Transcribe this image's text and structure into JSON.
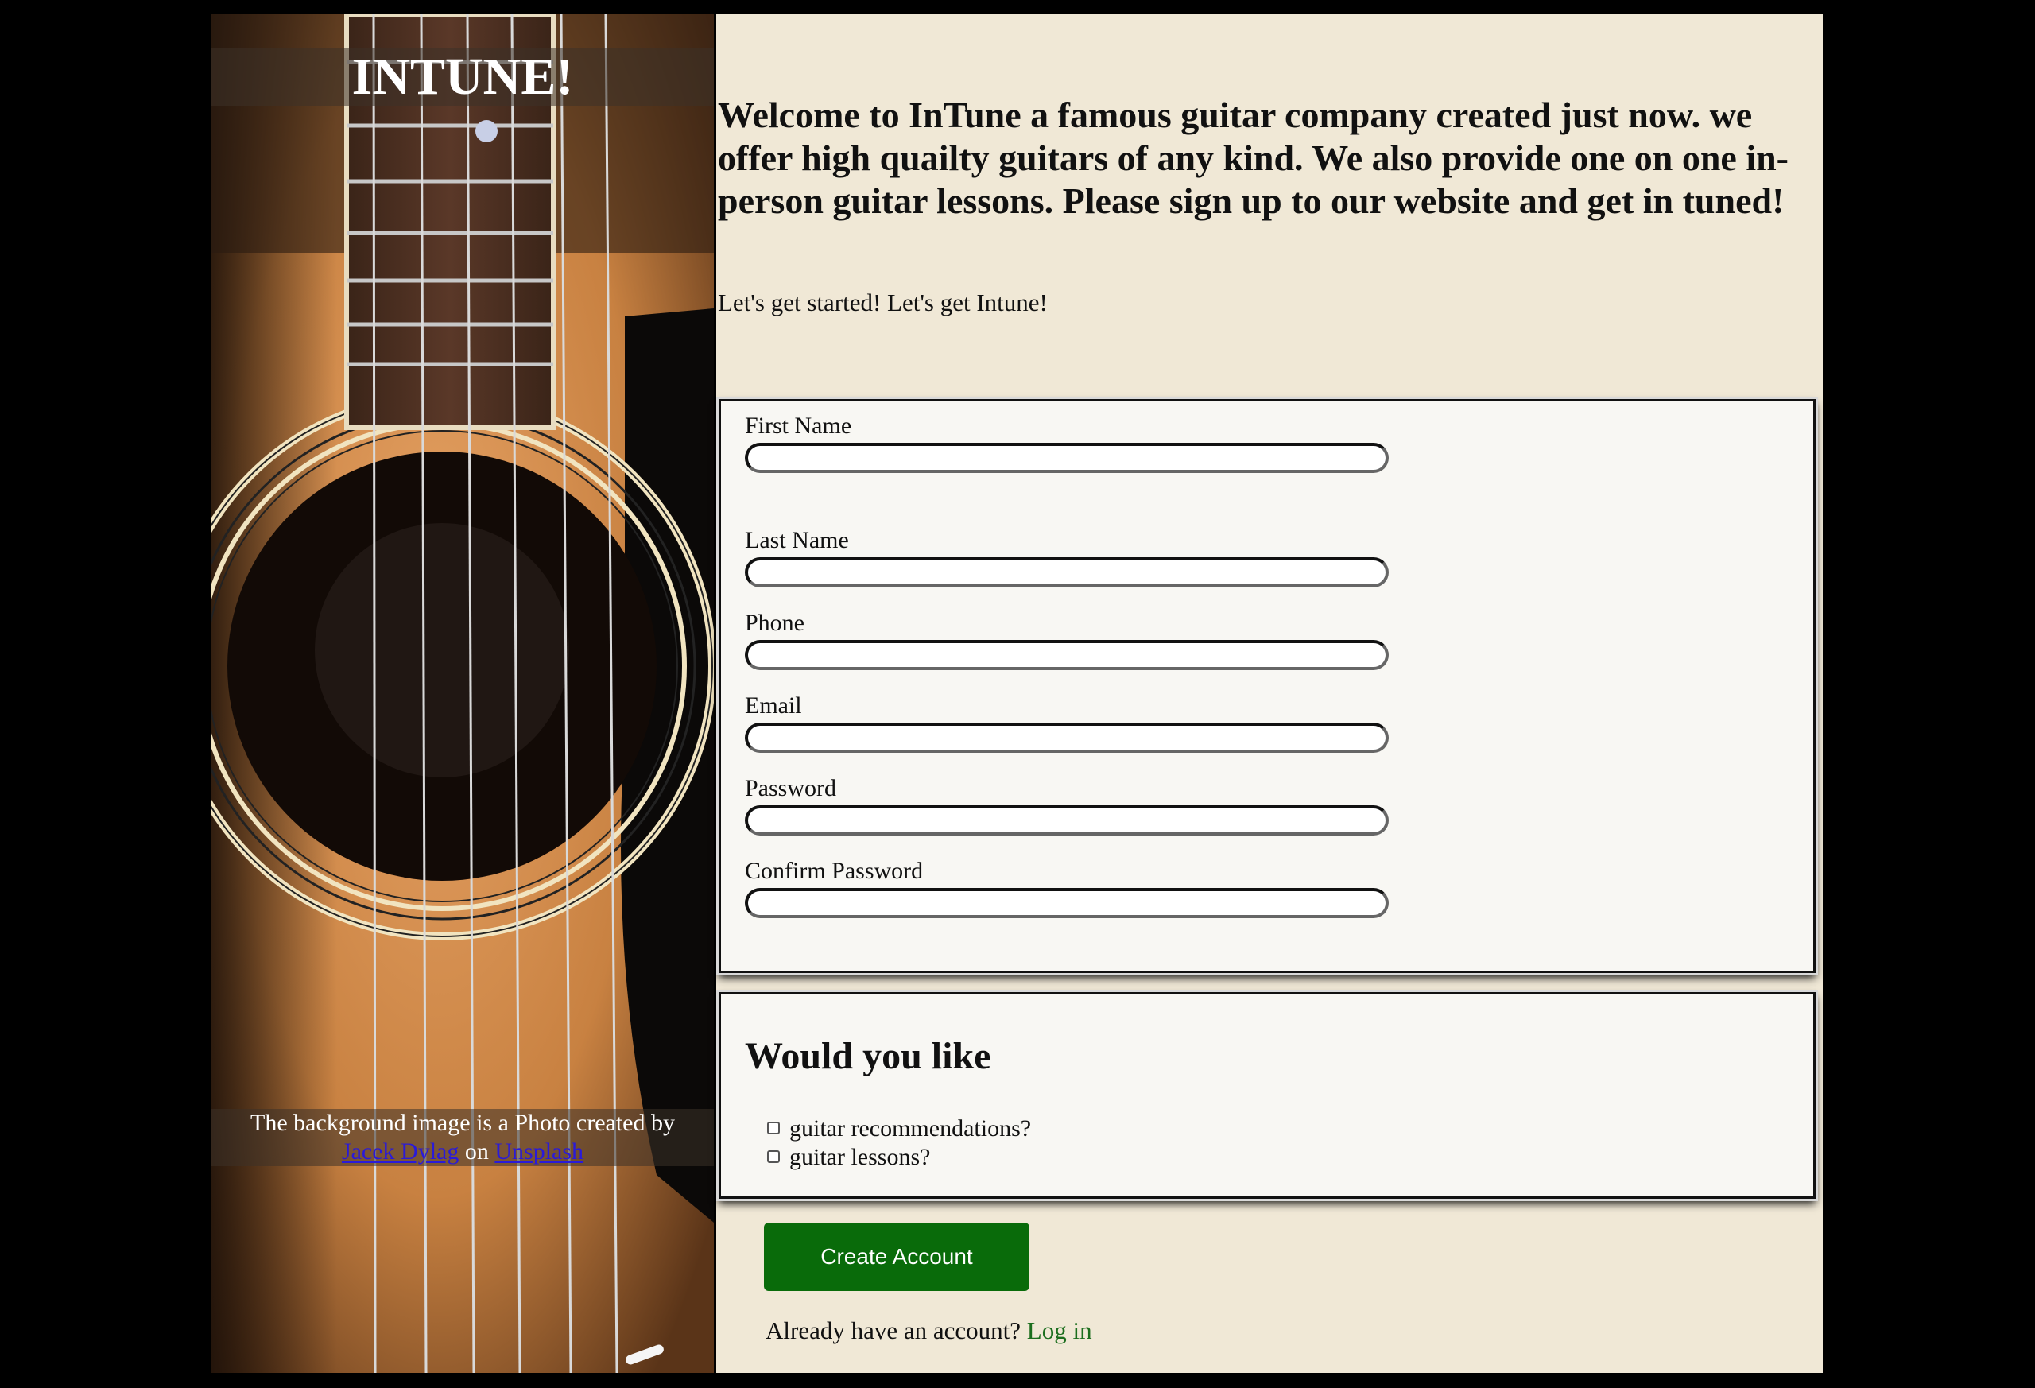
{
  "brand": {
    "title": "INTUNE!"
  },
  "credit": {
    "text_before": "The background image is a Photo created by",
    "author_link": "Jacek Dylag",
    "between": "on",
    "site_link": "Unsplash"
  },
  "intro": {
    "headline": "Welcome to InTune a famous guitar company created just now. we offer high quailty guitars of any kind. We also provide one on one in-person guitar lessons. Please sign up to our website and get in tuned!",
    "subtext": "Let's get started! Let's get Intune!"
  },
  "form": {
    "fields": [
      {
        "label": "First Name",
        "value": ""
      },
      {
        "label": "Last Name",
        "value": ""
      },
      {
        "label": "Phone",
        "value": ""
      },
      {
        "label": "Email",
        "value": ""
      },
      {
        "label": "Password",
        "value": ""
      },
      {
        "label": "Confirm Password",
        "value": ""
      }
    ],
    "options_title": "Would you like",
    "options": [
      {
        "label": "guitar recommendations?",
        "checked": false
      },
      {
        "label": "guitar lessons?",
        "checked": false
      }
    ],
    "submit_label": "Create Account",
    "login_prompt": "Already have an account?",
    "login_link": "Log in"
  },
  "colors": {
    "page_bg": "#000000",
    "content_bg": "#f0e8d6",
    "fieldset_bg": "#f8f7f3",
    "button_bg": "#096b0a",
    "login_link": "#1c6e1e",
    "credit_link": "#2a1ad9"
  }
}
